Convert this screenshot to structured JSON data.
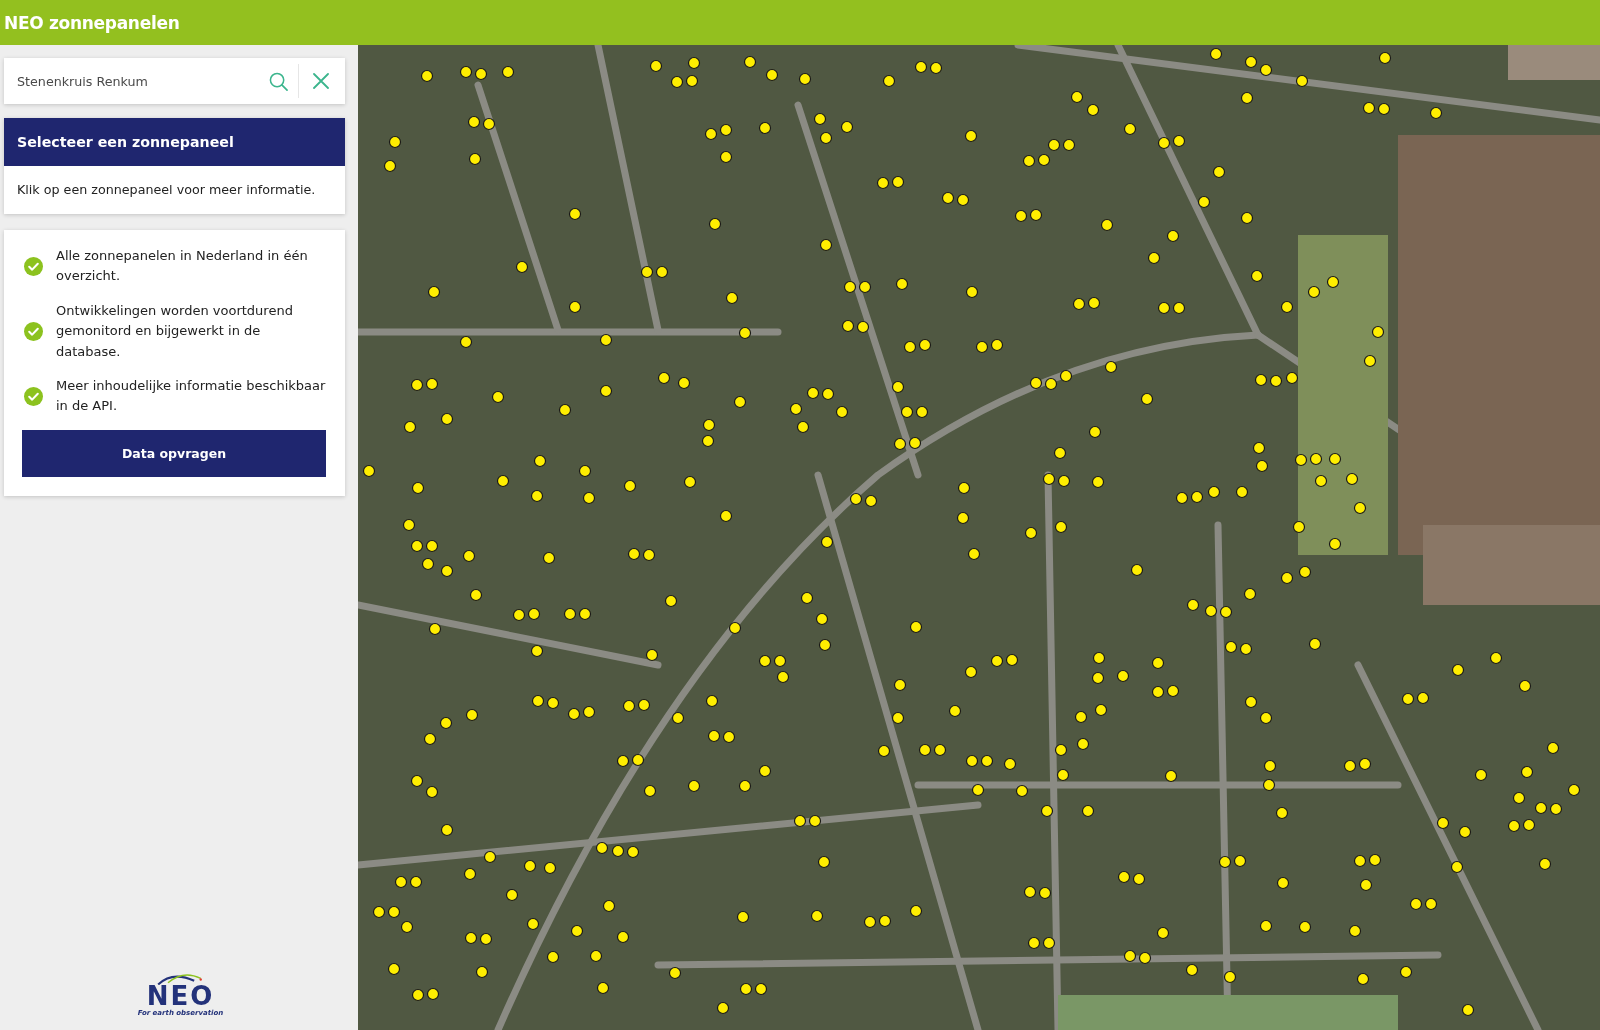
{
  "header": {
    "title": "NEO zonnepanelen"
  },
  "search": {
    "value": "Stenenkruis Renkum"
  },
  "info_card": {
    "title": "Selecteer een zonnepaneel",
    "text": "Klik op een zonnepaneel voor meer informatie."
  },
  "features": {
    "items": [
      {
        "text": "Alle zonnepanelen in Nederland in één overzicht."
      },
      {
        "text": "Ontwikkelingen worden voortdurend gemonitord en bijgewerkt in de database."
      },
      {
        "text": "Meer inhoudelijke informatie beschikbaar in de API."
      }
    ],
    "button": "Data opvragen"
  },
  "logo": {
    "wordmark": "NEO",
    "tagline": "For earth observation"
  }
}
